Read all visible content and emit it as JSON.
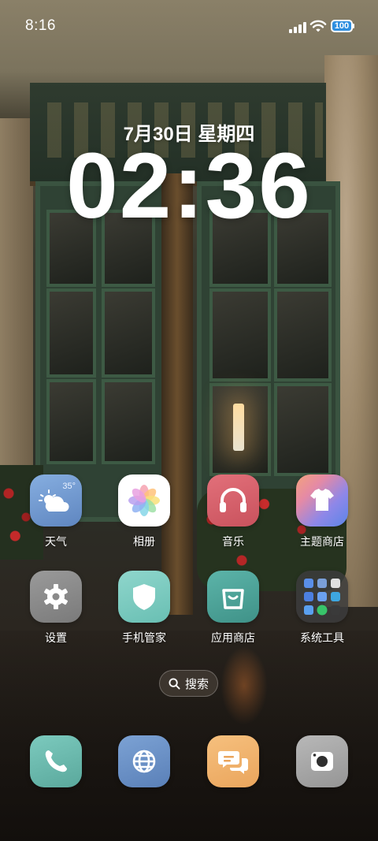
{
  "status_bar": {
    "time": "8:16",
    "battery_level": "100",
    "signal_icon": "cellular-signal-icon",
    "wifi_icon": "wifi-icon"
  },
  "lockclock": {
    "date": "7月30日 星期四",
    "time": "02:36"
  },
  "apps": [
    {
      "label": "天气",
      "icon": "weather-icon",
      "color": "#6f9ad0",
      "temp": "35°"
    },
    {
      "label": "相册",
      "icon": "gallery-flower-icon",
      "color": "#ffffff"
    },
    {
      "label": "音乐",
      "icon": "headphones-icon",
      "color": "#d8606a"
    },
    {
      "label": "主题商店",
      "icon": "tshirt-icon",
      "color": "#8b86e0"
    },
    {
      "label": "设置",
      "icon": "gear-icon",
      "color": "#8a8a8a"
    },
    {
      "label": "手机管家",
      "icon": "shield-icon",
      "color": "#78c9bf"
    },
    {
      "label": "应用商店",
      "icon": "shopping-bag-icon",
      "color": "#4fa49a"
    },
    {
      "label": "系统工具",
      "icon": "folder-icon",
      "color": "#3b3b3b"
    }
  ],
  "search": {
    "label": "搜索",
    "icon": "search-icon"
  },
  "dock": [
    {
      "name": "phone",
      "icon": "phone-icon",
      "color": "#6fbdb0"
    },
    {
      "name": "browser",
      "icon": "globe-icon",
      "color": "#6f94c8"
    },
    {
      "name": "messages",
      "icon": "chat-bubbles-icon",
      "color": "#f2b46e"
    },
    {
      "name": "camera",
      "icon": "camera-icon",
      "color": "#a7a7a7"
    }
  ]
}
